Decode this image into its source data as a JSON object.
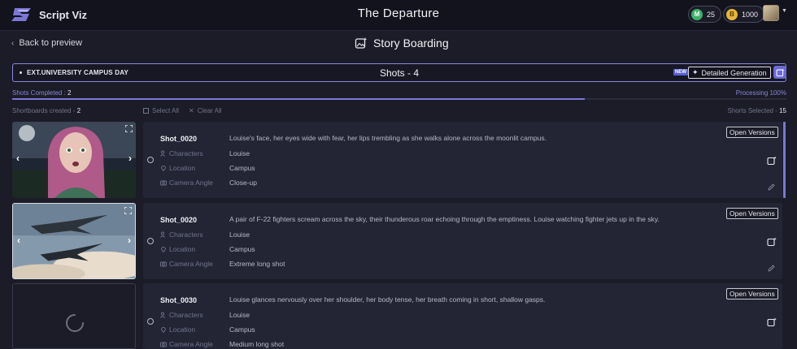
{
  "app": {
    "name": "Script Viz",
    "project_title": "The Departure"
  },
  "credits": [
    {
      "icon": "m-coin-icon",
      "value": "25",
      "color": "#3bb36a"
    },
    {
      "icon": "gold-coin-icon",
      "value": "1000",
      "color": "#e6b53a"
    }
  ],
  "nav": {
    "back_label": "Back to preview",
    "section_title": "Story Boarding"
  },
  "scene": {
    "name": "EXT.UNIVERSITY CAMPUS DAY",
    "shots_label": "Shots - 4",
    "new_badge": "NEW",
    "detailed_generation_label": "Detailed Generation"
  },
  "progress": {
    "completed_label": "Shots Completed :",
    "completed_value": "2",
    "processing_label": "Processing 100%",
    "fraction": 0.74
  },
  "toolbar": {
    "shortboards_label": "Shortboards created -",
    "shortboards_value": "2",
    "select_all": "Select All",
    "clear_all": "Clear All",
    "selected_label": "Shorts Selected -",
    "selected_value": "15"
  },
  "field_labels": {
    "characters": "Characters",
    "location": "Location",
    "camera_angle": "Camera Angle"
  },
  "open_versions_label": "Open Versions",
  "shots": [
    {
      "id": "Shot_0020",
      "description": "Louise's face, her eyes wide with fear, her lips trembling as she walks alone across the moonlit campus.",
      "characters": "Louise",
      "location": "Campus",
      "camera_angle": "Close-up",
      "thumbnail": "girl-portrait-image"
    },
    {
      "id": "Shot_0020",
      "description": "A pair of F-22 fighters scream across the sky, their thunderous roar echoing through the emptiness. Louise watching fighter jets up in the sky.",
      "characters": "Louise",
      "location": "Campus",
      "camera_angle": "Extreme long shot",
      "thumbnail": "fighter-jets-image"
    },
    {
      "id": "Shot_0030",
      "description": "Louise glances nervously over her shoulder, her body tense, her breath coming in short, shallow gasps.",
      "characters": "Louise",
      "location": "Campus",
      "camera_angle": "Medium long shot",
      "thumbnail": "loading-spinner-icon"
    }
  ],
  "colors": {
    "accent": "#7c77d6",
    "background": "#1b1c27",
    "card": "#232535"
  }
}
